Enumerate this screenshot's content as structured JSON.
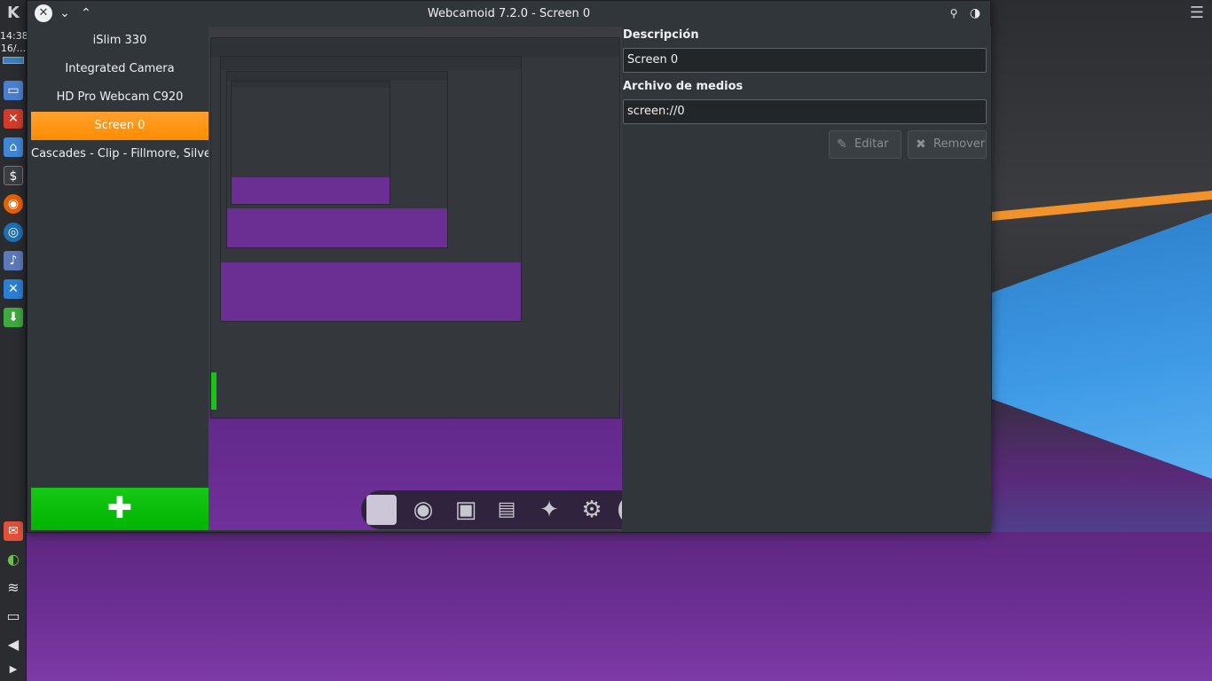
{
  "window": {
    "title": "Webcamoid 7.2.0 - Screen 0"
  },
  "taskbar": {
    "clock_time": "14:38",
    "clock_date": "16/..."
  },
  "devices": [
    {
      "label": "iSlim 330",
      "selected": false
    },
    {
      "label": "Integrated Camera",
      "selected": false
    },
    {
      "label": "HD Pro Webcam C920",
      "selected": false
    },
    {
      "label": "Screen 0",
      "selected": true
    },
    {
      "label": "Cascades - Clip - Fillmore, Silver Sp",
      "selected": false
    }
  ],
  "add_button": {
    "icon": "plus-icon",
    "color": "#00b400"
  },
  "form": {
    "description_label": "Descripción",
    "description_value": "Screen 0",
    "media_file_label": "Archivo de medios",
    "media_file_value": "screen://0",
    "edit_label": "Editar",
    "remove_label": "Remover"
  },
  "toolbar": {
    "items": [
      "stop-icon",
      "webcam-icon",
      "camera-icon",
      "film-icon",
      "magic-wand-icon",
      "gear-icon",
      "info-icon"
    ]
  },
  "colors": {
    "selected": "#ff8c00",
    "add": "#00b400",
    "window_bg": "#31363b"
  }
}
